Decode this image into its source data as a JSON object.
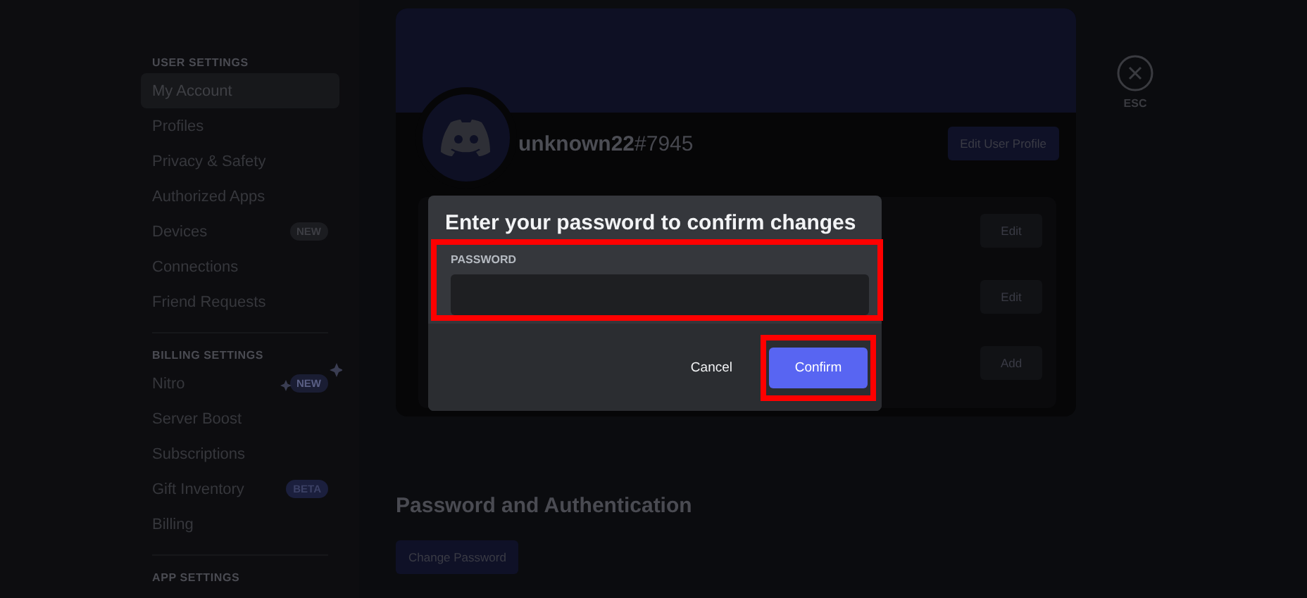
{
  "sidebar": {
    "sections": [
      {
        "heading": "USER SETTINGS",
        "items": [
          {
            "label": "My Account",
            "selected": true
          },
          {
            "label": "Profiles",
            "selected": false
          },
          {
            "label": "Privacy & Safety",
            "selected": false
          },
          {
            "label": "Authorized Apps",
            "selected": false
          },
          {
            "label": "Devices",
            "selected": false,
            "badge": {
              "text": "NEW",
              "kind": "plain"
            }
          },
          {
            "label": "Connections",
            "selected": false
          },
          {
            "label": "Friend Requests",
            "selected": false
          }
        ]
      },
      {
        "heading": "BILLING SETTINGS",
        "items": [
          {
            "label": "Nitro",
            "selected": false,
            "badge": {
              "text": "NEW",
              "kind": "sparkle"
            }
          },
          {
            "label": "Server Boost",
            "selected": false
          },
          {
            "label": "Subscriptions",
            "selected": false
          },
          {
            "label": "Gift Inventory",
            "selected": false,
            "badge": {
              "text": "BETA",
              "kind": "brand"
            }
          },
          {
            "label": "Billing",
            "selected": false
          }
        ]
      },
      {
        "heading": "APP SETTINGS"
      }
    ]
  },
  "profile": {
    "username": "unknown22",
    "discriminator": "#7945",
    "edit_button": "Edit User Profile",
    "row_buttons": [
      "Edit",
      "Edit",
      "Add"
    ]
  },
  "close": {
    "label": "ESC"
  },
  "password_section": {
    "title": "Password and Authentication",
    "button": "Change Password"
  },
  "dialog": {
    "title": "Enter your password to confirm changes",
    "field_label": "PASSWORD",
    "field_highlighted": true,
    "cancel": "Cancel",
    "confirm": "Confirm",
    "confirm_highlighted": true
  }
}
